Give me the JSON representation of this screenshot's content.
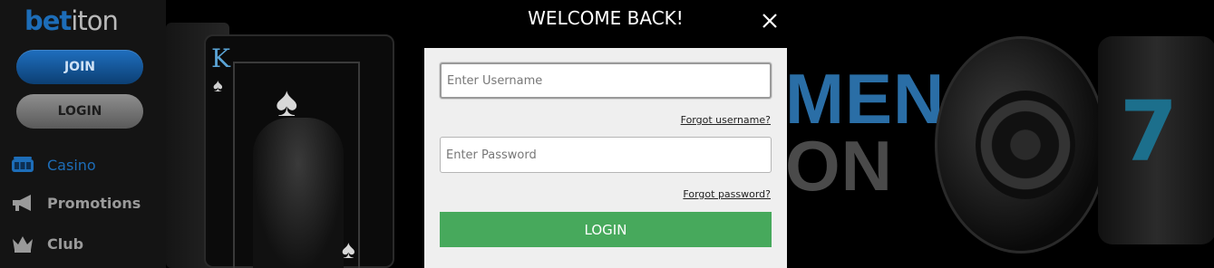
{
  "brand": {
    "logo_part1": "bet",
    "logo_part2": "iton"
  },
  "sidebar": {
    "join_label": "JOIN",
    "login_label": "LOGIN",
    "items": [
      {
        "label": "Casino",
        "icon": "slot-machine-icon",
        "active": true
      },
      {
        "label": "Promotions",
        "icon": "megaphone-icon",
        "active": false
      },
      {
        "label": "Club",
        "icon": "crown-icon",
        "active": false
      }
    ]
  },
  "background": {
    "promo_line1": "MEN",
    "promo_line2": "ON",
    "card_rank": "K",
    "slot_symbol": "7"
  },
  "modal": {
    "title": "WELCOME BACK!",
    "username_placeholder": "Enter Username",
    "password_placeholder": "Enter Password",
    "forgot_username": "Forgot username?",
    "forgot_password": "Forgot password?",
    "login_button": "LOGIN"
  },
  "colors": {
    "brand_blue": "#1d6db8",
    "login_green": "#47a95c",
    "modal_bg": "#efefef"
  }
}
